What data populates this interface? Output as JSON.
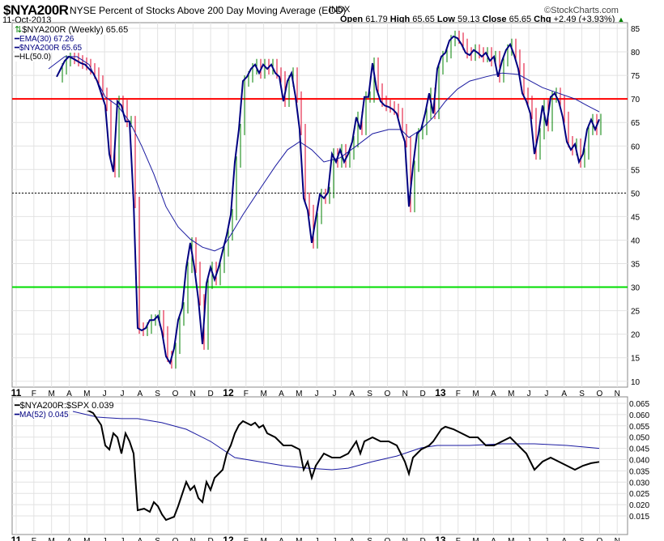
{
  "header": {
    "symbol": "$NYA200R",
    "description": "NYSE Percent of Stocks Above 200 Day Moving Average (EOD)",
    "exchange": "INDX",
    "date": "11-Oct-2013",
    "brand": "©StockCharts.com",
    "open_label": "Open",
    "open": "61.79",
    "high_label": "High",
    "high": "65.65",
    "low_label": "Low",
    "low": "59.13",
    "close_label": "Close",
    "close": "65.65",
    "chg_label": "Chg",
    "chg": "+2.49 (+3.93%)",
    "chg_arrow": "▲"
  },
  "colors": {
    "price": "#000080",
    "ema": "#1a1aa0",
    "up": "#008000",
    "down": "#e0002a",
    "line70": "#ff0000",
    "line30": "#00dd00",
    "ratio": "#000000",
    "ma": "#1a1aa0"
  },
  "chart_data": [
    {
      "type": "line",
      "title": "$NYA200R (Weekly) 65.65",
      "legend": [
        "$NYA200R (Weekly) 65.65",
        "EMA(30) 67.26",
        "$NYA200R 65.65",
        "HL(50.0)"
      ],
      "legend_placement": "top-left",
      "x_unit": "weeks since Jan 2011",
      "ylim": [
        10,
        85
      ],
      "yticks": [
        10,
        15,
        20,
        25,
        30,
        35,
        40,
        45,
        50,
        55,
        60,
        65,
        70,
        75,
        80,
        85
      ],
      "xticks": [
        "11",
        "F",
        "M",
        "A",
        "M",
        "J",
        "J",
        "A",
        "S",
        "O",
        "N",
        "D",
        "12",
        "F",
        "M",
        "A",
        "M",
        "J",
        "J",
        "A",
        "S",
        "O",
        "N",
        "D",
        "13",
        "F",
        "M",
        "A",
        "M",
        "J",
        "J",
        "A",
        "S",
        "O",
        "N"
      ],
      "hlines": [
        {
          "value": 70,
          "color": "red"
        },
        {
          "value": 30,
          "color": "green"
        },
        {
          "value": 50,
          "style": "dotted"
        }
      ],
      "close_start_week": 10,
      "close": [
        74.7,
        76.4,
        78.1,
        79.0,
        78.6,
        78.1,
        77.6,
        77.3,
        76.4,
        75.5,
        73.8,
        71.2,
        68.6,
        58.3,
        54.5,
        69.5,
        68.6,
        65.2,
        65.2,
        48.0,
        21.3,
        20.8,
        21.3,
        23.0,
        23.0,
        23.9,
        20.5,
        15.3,
        13.9,
        17.0,
        23.0,
        25.6,
        34.2,
        39.4,
        34.2,
        27.3,
        17.9,
        30.8,
        34.2,
        31.6,
        34.2,
        37.7,
        41.1,
        45.4,
        56.6,
        63.5,
        73.8,
        74.7,
        76.4,
        77.3,
        75.5,
        77.3,
        76.4,
        77.3,
        75.5,
        74.7,
        69.5,
        73.8,
        75.5,
        70.4,
        63.5,
        48.9,
        46.3,
        39.4,
        44.6,
        49.7,
        48.9,
        50.1,
        58.3,
        56.6,
        59.2,
        56.6,
        58.3,
        60.9,
        66.1,
        63.5,
        70.4,
        70.4,
        77.6,
        72.1,
        69.5,
        68.6,
        68.3,
        67.8,
        66.9,
        63.5,
        60.9,
        47.1,
        55.7,
        62.6,
        63.5,
        66.9,
        71.2,
        66.9,
        76.4,
        79.0,
        79.8,
        82.4,
        83.3,
        82.9,
        81.6,
        79.8,
        79.3,
        80.4,
        79.8,
        79.0,
        79.8,
        78.1,
        79.0,
        74.7,
        78.1,
        80.4,
        81.6,
        79.3,
        76.4,
        71.2,
        69.5,
        66.9,
        58.3,
        62.6,
        68.6,
        64.3,
        70.4,
        71.2,
        69.5,
        66.1,
        60.9,
        59.2,
        60.4,
        56.6,
        58.3,
        63.5,
        65.6,
        63.5,
        65.65
      ],
      "ema30": [
        [
          8,
          76.4
        ],
        [
          12,
          79.0
        ],
        [
          15,
          79.0
        ],
        [
          18,
          77.3
        ],
        [
          20,
          73.8
        ],
        [
          22,
          70.4
        ],
        [
          25,
          68.6
        ],
        [
          28,
          65.2
        ],
        [
          31,
          60.0
        ],
        [
          34,
          54.0
        ],
        [
          37,
          47.1
        ],
        [
          40,
          42.8
        ],
        [
          43,
          40.2
        ],
        [
          46,
          38.5
        ],
        [
          49,
          37.7
        ],
        [
          51,
          38.5
        ],
        [
          53,
          41.1
        ],
        [
          56,
          45.4
        ],
        [
          60,
          50.6
        ],
        [
          64,
          55.7
        ],
        [
          67,
          59.2
        ],
        [
          70,
          60.9
        ],
        [
          73,
          59.2
        ],
        [
          76,
          56.6
        ],
        [
          80,
          57.5
        ],
        [
          84,
          60.0
        ],
        [
          88,
          62.6
        ],
        [
          92,
          63.5
        ],
        [
          95,
          63.5
        ],
        [
          97,
          61.8
        ],
        [
          100,
          63.5
        ],
        [
          103,
          66.1
        ],
        [
          106,
          69.5
        ],
        [
          109,
          72.1
        ],
        [
          112,
          73.8
        ],
        [
          116,
          74.7
        ],
        [
          120,
          75.5
        ],
        [
          124,
          75.2
        ],
        [
          127,
          73.8
        ],
        [
          130,
          72.4
        ],
        [
          134,
          71.2
        ],
        [
          138,
          70.0
        ],
        [
          141,
          68.6
        ],
        [
          144,
          67.26
        ]
      ]
    },
    {
      "type": "line",
      "legend": [
        "$NYA200R:$SPX 0.039",
        "MA(52) 0.045"
      ],
      "legend_placement": "top-left",
      "ylim": [
        0.015,
        0.065
      ],
      "yticks": [
        "0.015",
        "0.020",
        "0.025",
        "0.030",
        "0.035",
        "0.040",
        "0.045",
        "0.050",
        "0.055",
        "0.060",
        "0.065"
      ],
      "ratio": [
        [
          15,
          0.065
        ],
        [
          17,
          0.0625
        ],
        [
          19,
          0.0607
        ],
        [
          21,
          0.0553
        ],
        [
          22,
          0.0463
        ],
        [
          23,
          0.0445
        ],
        [
          24,
          0.0517
        ],
        [
          25,
          0.0499
        ],
        [
          26,
          0.0427
        ],
        [
          27,
          0.0517
        ],
        [
          28,
          0.0481
        ],
        [
          29,
          0.0427
        ],
        [
          30,
          0.0175
        ],
        [
          31.6,
          0.0182
        ],
        [
          33,
          0.0168
        ],
        [
          34,
          0.0211
        ],
        [
          35,
          0.0193
        ],
        [
          36,
          0.0157
        ],
        [
          37,
          0.0132
        ],
        [
          38,
          0.0139
        ],
        [
          39,
          0.0146
        ],
        [
          40,
          0.0193
        ],
        [
          41,
          0.0247
        ],
        [
          42,
          0.0301
        ],
        [
          43,
          0.0265
        ],
        [
          44,
          0.0283
        ],
        [
          45,
          0.0229
        ],
        [
          46,
          0.0211
        ],
        [
          47,
          0.0301
        ],
        [
          48,
          0.0265
        ],
        [
          49,
          0.0319
        ],
        [
          50,
          0.0337
        ],
        [
          51,
          0.0355
        ],
        [
          52,
          0.0427
        ],
        [
          53,
          0.0463
        ],
        [
          54,
          0.0517
        ],
        [
          55,
          0.0553
        ],
        [
          56,
          0.0571
        ],
        [
          58,
          0.0553
        ],
        [
          59,
          0.0564
        ],
        [
          60,
          0.0542
        ],
        [
          61,
          0.0553
        ],
        [
          62,
          0.0517
        ],
        [
          64,
          0.0499
        ],
        [
          66,
          0.0463
        ],
        [
          68,
          0.0463
        ],
        [
          70,
          0.0445
        ],
        [
          71,
          0.0355
        ],
        [
          72,
          0.0391
        ],
        [
          73,
          0.0319
        ],
        [
          74,
          0.0373
        ],
        [
          76,
          0.0427
        ],
        [
          78,
          0.0409
        ],
        [
          80,
          0.0409
        ],
        [
          82,
          0.0427
        ],
        [
          84,
          0.0481
        ],
        [
          85,
          0.0427
        ],
        [
          86,
          0.0481
        ],
        [
          88,
          0.0499
        ],
        [
          90,
          0.0481
        ],
        [
          92,
          0.0481
        ],
        [
          94,
          0.0463
        ],
        [
          96,
          0.0391
        ],
        [
          97,
          0.0337
        ],
        [
          98,
          0.0409
        ],
        [
          100,
          0.0445
        ],
        [
          102,
          0.0463
        ],
        [
          103,
          0.0481
        ],
        [
          105,
          0.0535
        ],
        [
          106,
          0.0546
        ],
        [
          108,
          0.0535
        ],
        [
          110,
          0.0517
        ],
        [
          112,
          0.0499
        ],
        [
          114,
          0.0499
        ],
        [
          116,
          0.0463
        ],
        [
          118,
          0.0463
        ],
        [
          120,
          0.0481
        ],
        [
          122,
          0.0499
        ],
        [
          124,
          0.0463
        ],
        [
          126,
          0.0427
        ],
        [
          128,
          0.0355
        ],
        [
          130,
          0.0391
        ],
        [
          132,
          0.0409
        ],
        [
          134,
          0.0391
        ],
        [
          136,
          0.0373
        ],
        [
          138,
          0.0355
        ],
        [
          140,
          0.0373
        ],
        [
          142,
          0.0384
        ],
        [
          144,
          0.039
        ]
      ],
      "ma52": [
        [
          14,
          0.0614
        ],
        [
          20,
          0.0589
        ],
        [
          26,
          0.0582
        ],
        [
          30,
          0.0582
        ],
        [
          36,
          0.0564
        ],
        [
          42,
          0.0535
        ],
        [
          48,
          0.0481
        ],
        [
          54,
          0.0409
        ],
        [
          60,
          0.0391
        ],
        [
          66,
          0.0373
        ],
        [
          72,
          0.0362
        ],
        [
          78,
          0.0355
        ],
        [
          82,
          0.0362
        ],
        [
          88,
          0.0391
        ],
        [
          94,
          0.0416
        ],
        [
          100,
          0.0452
        ],
        [
          104,
          0.0463
        ],
        [
          112,
          0.0463
        ],
        [
          120,
          0.047
        ],
        [
          128,
          0.047
        ],
        [
          136,
          0.0463
        ],
        [
          144,
          0.045
        ]
      ]
    }
  ]
}
